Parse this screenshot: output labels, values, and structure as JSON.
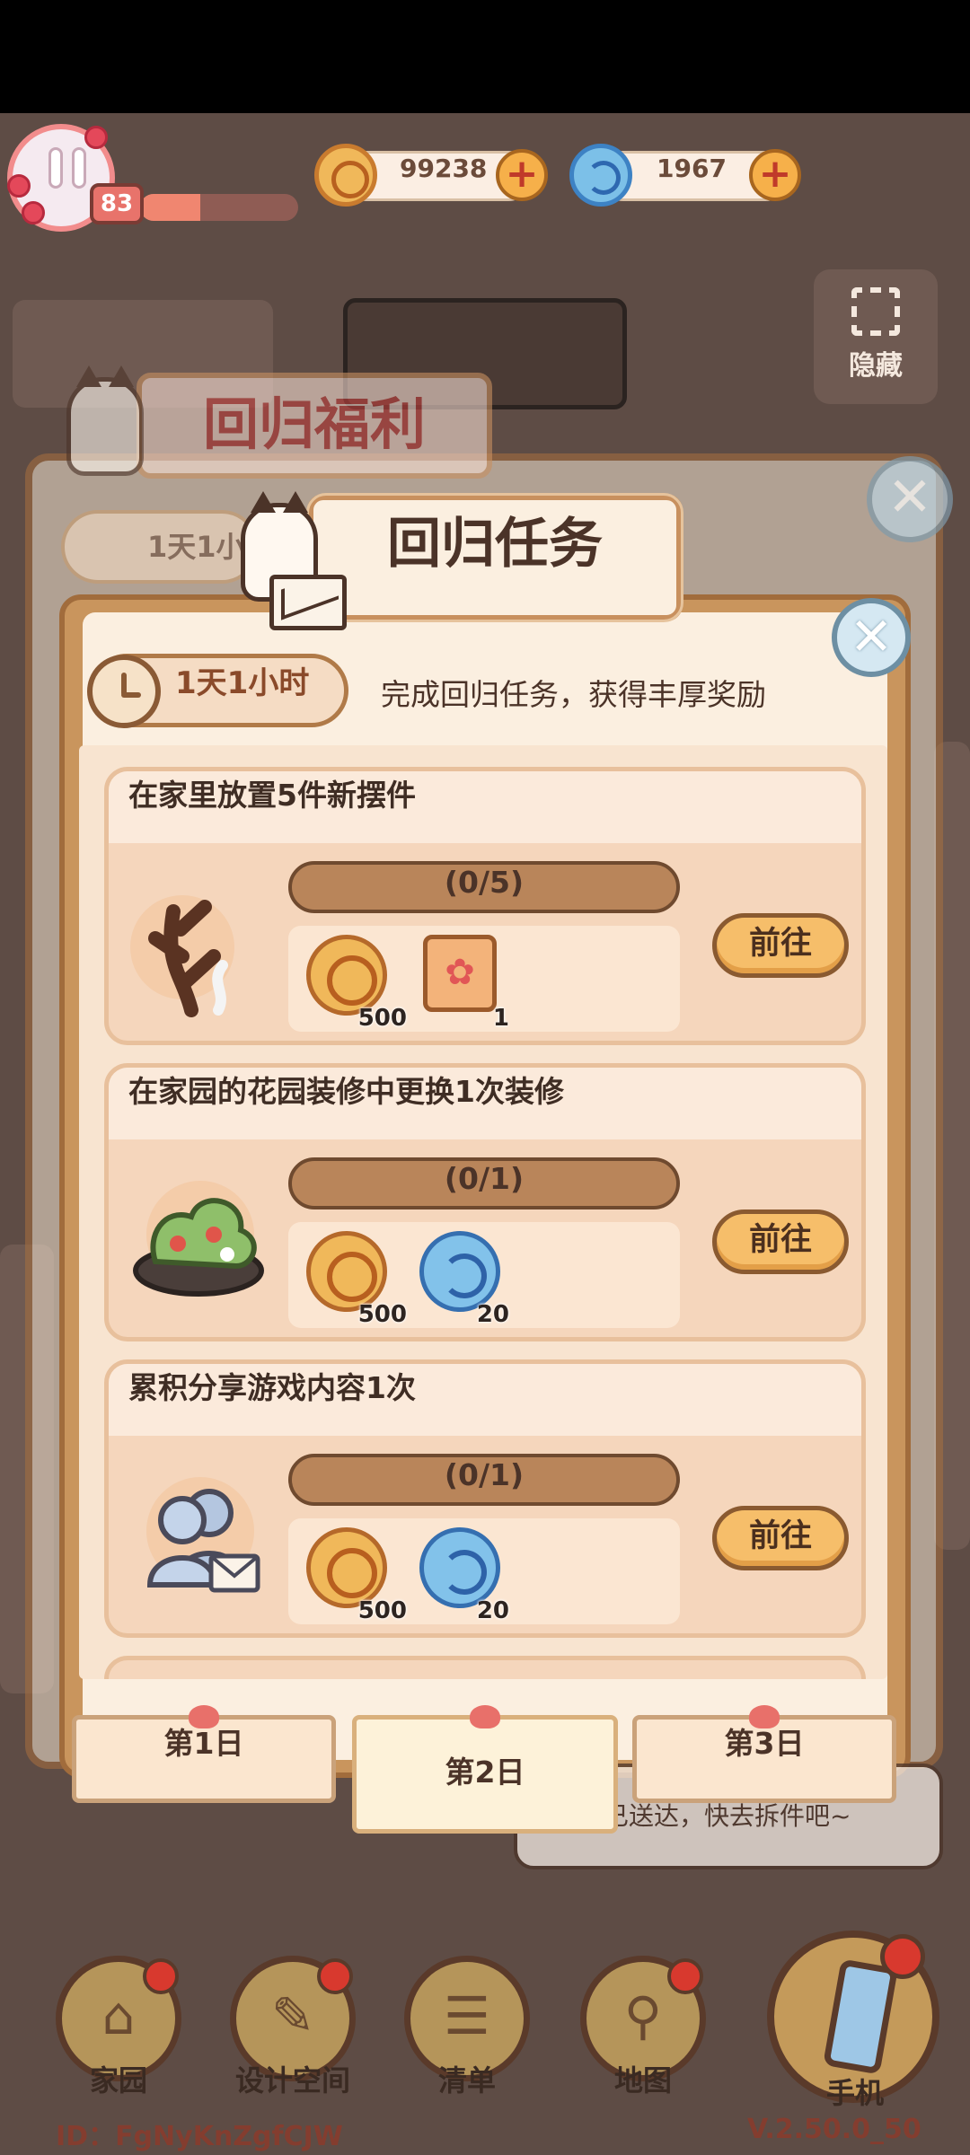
{
  "hud": {
    "level": "83",
    "xp_fraction": 0.38,
    "coins": "99238",
    "gems": "1967",
    "hide_label": "隐藏"
  },
  "back_panel": {
    "title": "回归福利",
    "timer": "1天1小"
  },
  "panel": {
    "title": "回归任务",
    "timer": "1天1小时",
    "subtitle": "完成回归任务，获得丰厚奖励"
  },
  "tasks": [
    {
      "title": "在家里放置5件新摆件",
      "progress_text": "(0/5)",
      "progress": 0,
      "icon": "branch-ornament-icon",
      "rewards": [
        {
          "icon": "coin-icon",
          "qty": "500"
        },
        {
          "icon": "paw-ticket-icon",
          "qty": "1"
        }
      ],
      "button": "前往"
    },
    {
      "title": "在家园的花园装修中更换1次装修",
      "progress_text": "(0/1)",
      "progress": 0,
      "icon": "flower-bush-icon",
      "rewards": [
        {
          "icon": "coin-icon",
          "qty": "500"
        },
        {
          "icon": "gem-icon",
          "qty": "20"
        }
      ],
      "button": "前往"
    },
    {
      "title": "累积分享游戏内容1次",
      "progress_text": "(0/1)",
      "progress": 0,
      "icon": "share-friends-icon",
      "rewards": [
        {
          "icon": "coin-icon",
          "qty": "500"
        },
        {
          "icon": "gem-icon",
          "qty": "20"
        }
      ],
      "button": "前往"
    }
  ],
  "tabs": [
    "第1日",
    "第2日",
    "第3日"
  ],
  "active_tab": 1,
  "bubble_text": "快递已送达，快去拆件吧~",
  "nav": {
    "home": "家园",
    "design": "设计空间",
    "list": "清单",
    "map": "地图",
    "phone": "手机"
  },
  "footer": {
    "user_id": "ID：FgNyKnZgfCJW",
    "version": "V.2.50.0_50"
  },
  "colors": {
    "panel_frame": "#c9955d",
    "button": "#f6be6a",
    "notification": "#d8392e"
  }
}
